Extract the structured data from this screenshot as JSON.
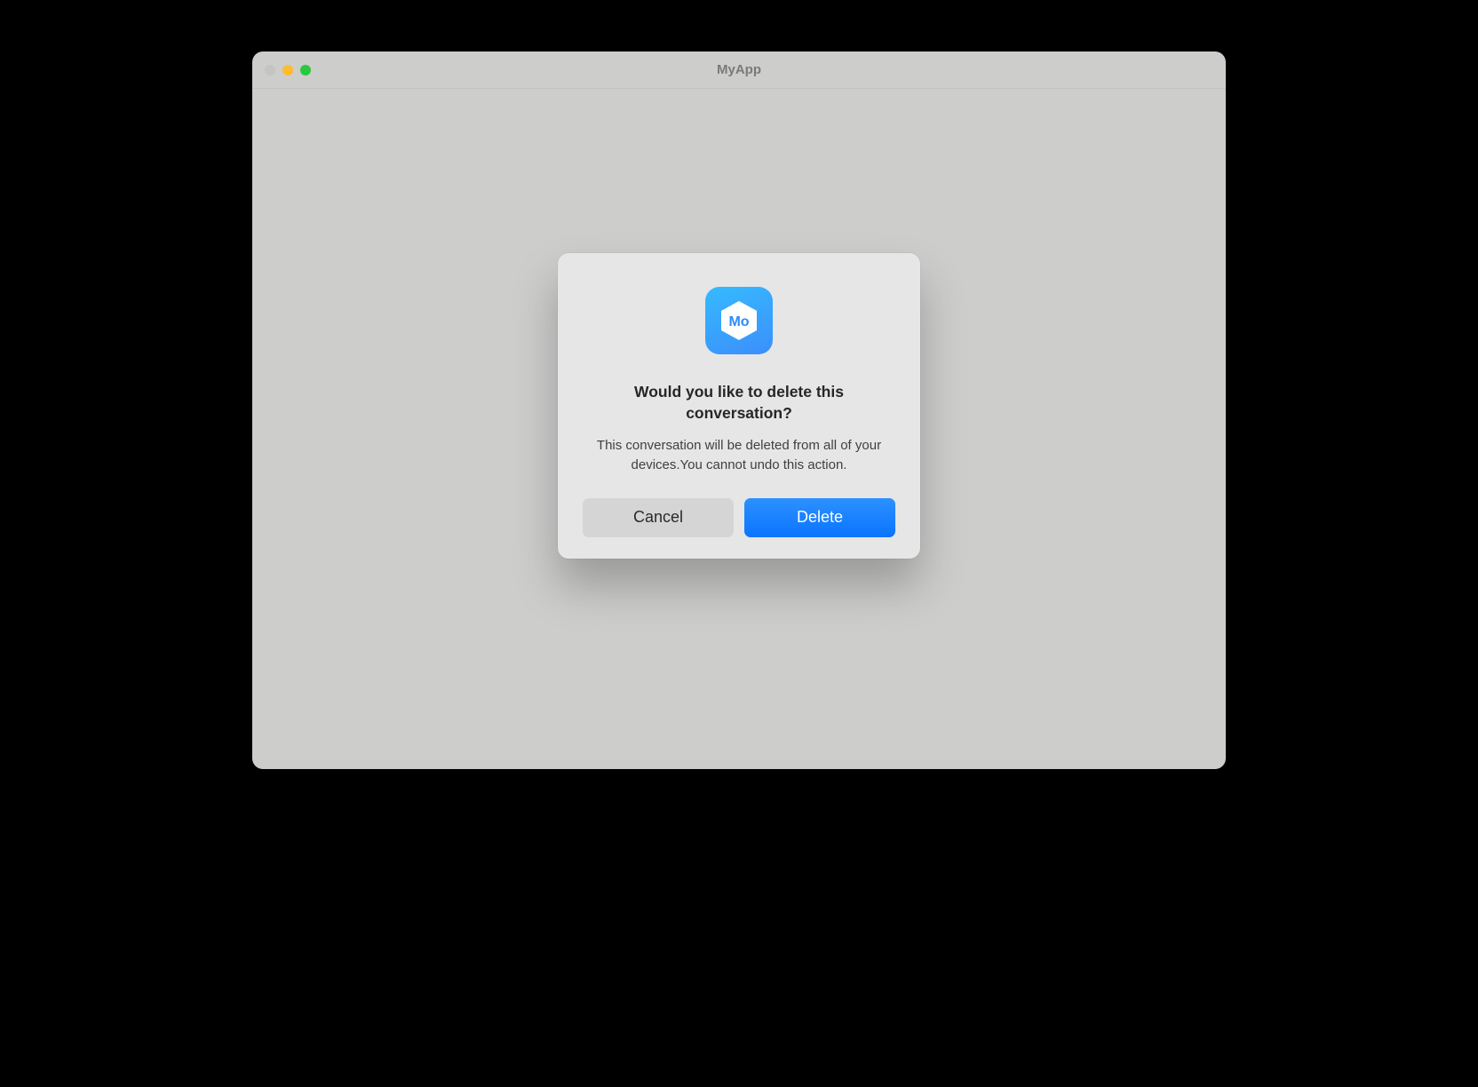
{
  "window": {
    "title": "MyApp"
  },
  "dialog": {
    "app_icon_label": "Mo",
    "title": "Would you like to delete this conversation?",
    "description": "This conversation will be deleted from all of your devices.You cannot undo this action.",
    "buttons": {
      "cancel": "Cancel",
      "delete": "Delete"
    }
  }
}
